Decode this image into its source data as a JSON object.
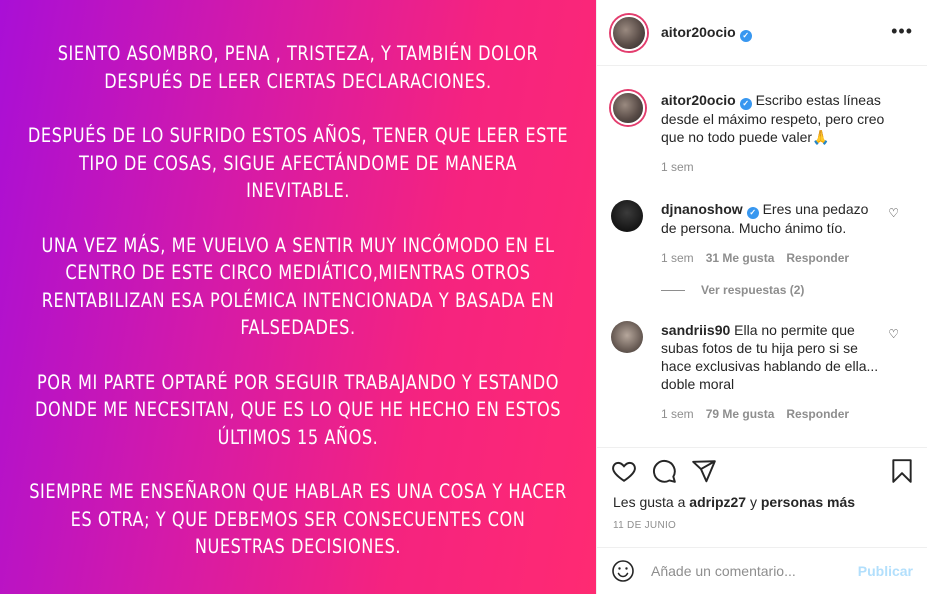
{
  "post": {
    "paragraphs": [
      "SIENTO ASOMBRO, PENA , TRISTEZA, Y TAMBIÉN DOLOR DESPUÉS DE LEER  CIERTAS DECLARACIONES.",
      "DESPUÉS DE LO SUFRIDO ESTOS AÑOS,  TENER QUE LEER ESTE TIPO DE COSAS, SIGUE AFECTÁNDOME  DE MANERA INEVITABLE.",
      "UNA VEZ MÁS, ME VUELVO A SENTIR MUY INCÓMODO EN EL CENTRO DE ESTE CIRCO MEDIÁTICO,MIENTRAS OTROS RENTABILIZAN ESA POLÉMICA INTENCIONADA Y BASADA EN FALSEDADES.",
      "POR MI PARTE OPTARÉ POR SEGUIR TRABAJANDO Y ESTANDO DONDE ME NECESITAN, QUE ES LO QUE HE HECHO EN ESTOS ÚLTIMOS 15 AÑOS.",
      "SIEMPRE ME ENSEÑARON QUE HABLAR ES  UNA COSA Y HACER ES OTRA; Y QUE  DEBEMOS SER CONSECUENTES CON NUESTRAS DECISIONES."
    ]
  },
  "header": {
    "username": "aitor20ocio",
    "verified_mark": "✓",
    "more_label": "•••"
  },
  "caption": {
    "username": "aitor20ocio",
    "text": "Escribo estas líneas desde el máximo respeto, pero creo que no todo puede valer🙏",
    "time": "1 sem"
  },
  "comments": [
    {
      "username": "djnanoshow",
      "verified": true,
      "text": "Eres una pedazo de persona. Mucho ánimo tío.",
      "time": "1 sem",
      "likes": "31 Me gusta",
      "reply_label": "Responder"
    },
    {
      "username": "sandriis90",
      "verified": false,
      "text": "Ella no permite que subas fotos de tu hija pero si se hace exclusivas hablando de ella... doble moral",
      "time": "1 sem",
      "likes": "79 Me gusta",
      "reply_label": "Responder"
    }
  ],
  "view_replies": "Ver respuestas (2)",
  "likes_line": {
    "prefix": "Les gusta a",
    "user": "adripz27",
    "connector": "y",
    "others": "personas más"
  },
  "date": "11 DE JUNIO",
  "add_comment": {
    "placeholder": "Añade un comentario...",
    "publish_label": "Publicar"
  },
  "colors": {
    "verified": "#3897f0",
    "publish_disabled": "#b2dffc",
    "gradient_start": "#a90fd6",
    "gradient_end": "#ff2a72"
  }
}
